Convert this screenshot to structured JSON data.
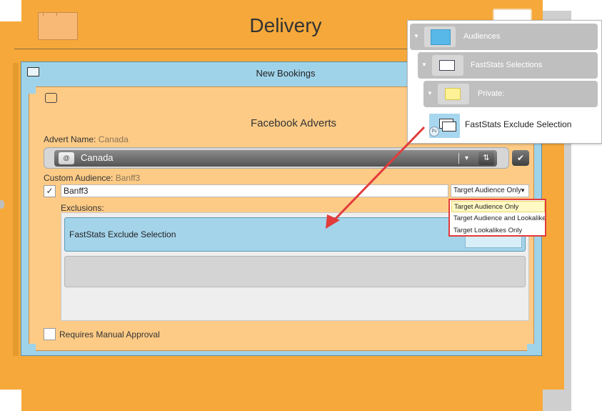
{
  "delivery": {
    "title": "Delivery"
  },
  "booking": {
    "title": "New Bookings"
  },
  "card": {
    "title": "Facebook Adverts",
    "advert_name_label": "Advert Name:",
    "advert_name_value": "Canada",
    "combo_at": "@",
    "combo_value": "Canada",
    "custom_audience_label": "Custom Audience:",
    "custom_audience_value": "Banff3",
    "audience_input_value": "Banff3",
    "target_select_value": "Target Audience Only",
    "exclusions_label": "Exclusions:",
    "exclusion_item": "FastStats Exclude Selection",
    "manual_approval_label": "Requires Manual Approval"
  },
  "dropdown_options": [
    "Target Audience Only",
    "Target Audience and Lookalikes",
    "Target Lookalikes Only"
  ],
  "tree": {
    "root": "Audiences",
    "child": "FastStats Selections",
    "folder": "Private:",
    "leaf": "FastStats Exclude Selection",
    "leaf_badge": "Ps"
  },
  "colors": {
    "outer_orange": "#f6a93a",
    "panel_blue": "#9fd3ea",
    "card_orange": "#fdcb86",
    "arrow_red": "#e23b3b"
  }
}
